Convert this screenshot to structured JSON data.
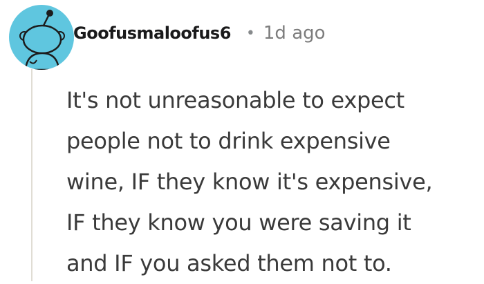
{
  "comment": {
    "author": "Goofusmaloofus6",
    "separator": "•",
    "timestamp": "1d ago",
    "avatar_icon": "reddit-snoo-avatar-icon",
    "avatar_color": "#5fc6df",
    "body_lines": [
      "It's not unreasonable to expect",
      "people not to drink expensive",
      "wine, IF they know it's expensive,",
      "IF they know you were saving it",
      "and IF you asked them not to."
    ]
  }
}
